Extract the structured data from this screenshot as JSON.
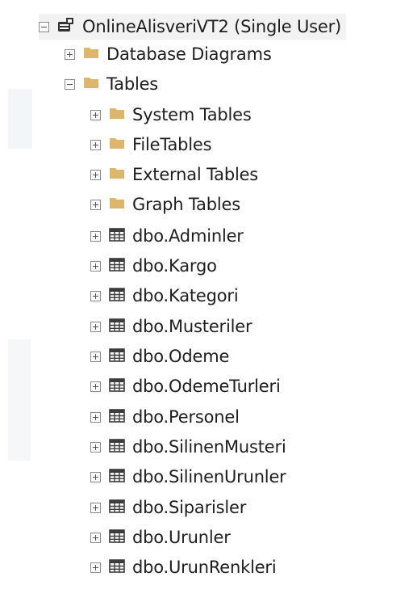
{
  "server": {
    "label": "OnlineAlisveriVT2 (Single User)",
    "icon": "database-icon"
  },
  "nodes": {
    "database_diagrams": {
      "label": "Database Diagrams",
      "icon": "folder-icon"
    },
    "tables": {
      "label": "Tables",
      "icon": "folder-icon"
    },
    "system_tables": {
      "label": "System Tables",
      "icon": "folder-icon"
    },
    "file_tables": {
      "label": "FileTables",
      "icon": "folder-icon"
    },
    "external_tables": {
      "label": "External Tables",
      "icon": "folder-icon"
    },
    "graph_tables": {
      "label": "Graph Tables",
      "icon": "folder-icon"
    }
  },
  "tables": [
    "dbo.Adminler",
    "dbo.Kargo",
    "dbo.Kategori",
    "dbo.Musteriler",
    "dbo.Odeme",
    "dbo.OdemeTurleri",
    "dbo.Personel",
    "dbo.SilinenMusteri",
    "dbo.SilinenUrunler",
    "dbo.Siparisler",
    "dbo.Urunler",
    "dbo.UrunRenkleri"
  ],
  "colors": {
    "folder": "#dcb66a",
    "grid": "#3c3c3c",
    "text": "#1e1e1e"
  }
}
